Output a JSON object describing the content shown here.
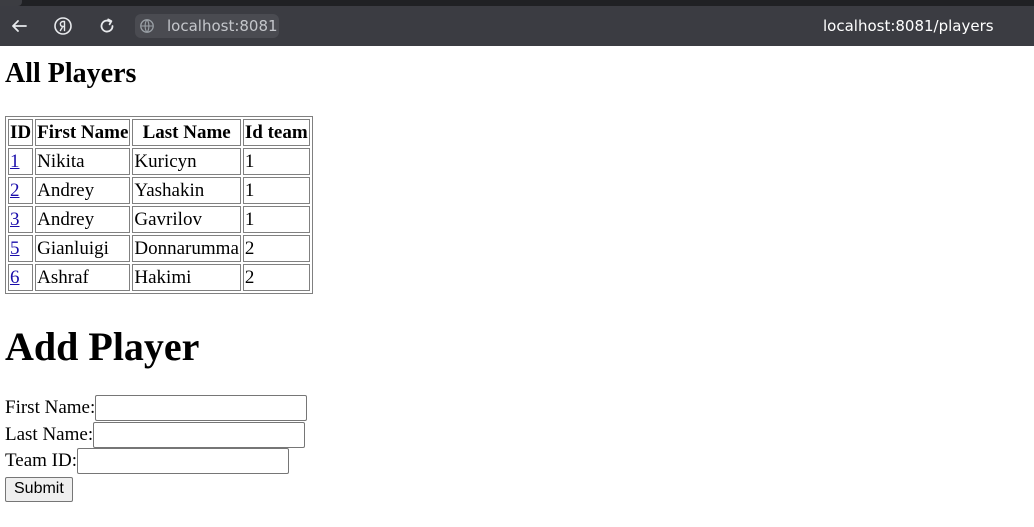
{
  "browser": {
    "address_chip": "localhost:8081",
    "page_url": "localhost:8081/players",
    "icons": [
      "back-arrow-icon",
      "yandex-icon",
      "reload-icon",
      "globe-icon"
    ]
  },
  "players_section": {
    "title": "All Players",
    "headers": [
      "ID",
      "First Name",
      "Last Name",
      "Id team"
    ],
    "rows": [
      {
        "id": "1",
        "first": "Nikita",
        "last": "Kuricyn",
        "team": "1"
      },
      {
        "id": "2",
        "first": "Andrey",
        "last": "Yashakin",
        "team": "1"
      },
      {
        "id": "3",
        "first": "Andrey",
        "last": "Gavrilov",
        "team": "1"
      },
      {
        "id": "5",
        "first": "Gianluigi",
        "last": "Donnarumma",
        "team": "2"
      },
      {
        "id": "6",
        "first": "Ashraf",
        "last": "Hakimi",
        "team": "2"
      }
    ]
  },
  "add_form": {
    "title": "Add Player",
    "first_name_label": "First Name:",
    "last_name_label": "Last Name:",
    "team_id_label": "Team ID:",
    "first_name_value": "",
    "last_name_value": "",
    "team_id_value": "",
    "submit_label": "Submit"
  },
  "colors": {
    "toolbar_bg": "#3b3c42",
    "link": "#1a0dab"
  }
}
